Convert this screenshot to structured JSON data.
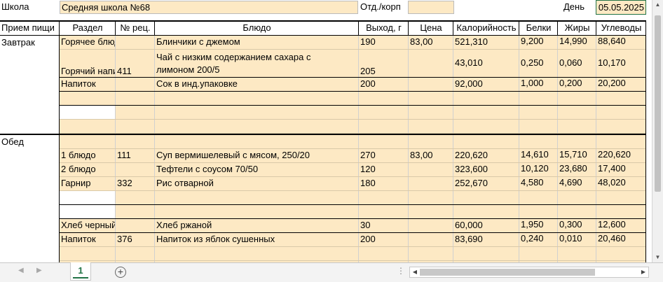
{
  "header": {
    "school_label": "Школа",
    "school_value": "Средняя школа №68",
    "dept_label": "Отд./корп",
    "dept_value": "",
    "day_label": "День",
    "day_value": "05.05.2025"
  },
  "columns": [
    "Прием пищи",
    "Раздел",
    "№ рец.",
    "Блюдо",
    "Выход, г",
    "Цена",
    "Калорийность",
    "Белки",
    "Жиры",
    "Углеводы"
  ],
  "meals": {
    "breakfast": "Завтрак",
    "lunch": "Обед"
  },
  "rows": [
    {
      "section": "Горячее блюдо",
      "recipe": "",
      "dish": "Блинчики с джемом",
      "dish2": "",
      "output": "190",
      "price": "83,00",
      "calories": "521,310",
      "proteins": "9,200",
      "fats": "14,990",
      "carbs": "88,640"
    },
    {
      "section": "Горячий напиток",
      "recipe": "411",
      "dish": "Чай с низким содержанием сахара с",
      "dish2": "лимоном 200/5",
      "output": "205",
      "price": "",
      "calories": "43,010",
      "proteins": "0,250",
      "fats": "0,060",
      "carbs": "10,170"
    },
    {
      "section": "Напиток",
      "recipe": "",
      "dish": "Сок в инд.упаковке",
      "dish2": "",
      "output": "200",
      "price": "",
      "calories": "92,000",
      "proteins": "1,000",
      "fats": "0,200",
      "carbs": "20,200"
    },
    {
      "section": "1 блюдо",
      "recipe": "111",
      "dish": "Суп вермишелевый с мясом, 250/20",
      "dish2": "",
      "output": "270",
      "price": "83,00",
      "calories": "220,620",
      "proteins": "14,610",
      "fats": "15,710",
      "carbs": "220,620"
    },
    {
      "section": "2 блюдо",
      "recipe": "",
      "dish": "Тефтели с соусом 70/50",
      "dish2": "",
      "output": "120",
      "price": "",
      "calories": "323,600",
      "proteins": "10,120",
      "fats": "23,680",
      "carbs": "17,400"
    },
    {
      "section": "Гарнир",
      "recipe": "332",
      "dish": "Рис отварной",
      "dish2": "",
      "output": "180",
      "price": "",
      "calories": "252,670",
      "proteins": "4,580",
      "fats": "4,690",
      "carbs": "48,020"
    },
    {
      "section": "Хлеб черный",
      "recipe": "",
      "dish": "Хлеб ржаной",
      "dish2": "",
      "output": "30",
      "price": "",
      "calories": "60,000",
      "proteins": "1,950",
      "fats": "0,300",
      "carbs": "12,600"
    },
    {
      "section": "Напиток",
      "recipe": "376",
      "dish": "Напиток из яблок сушенных",
      "dish2": "",
      "output": "200",
      "price": "",
      "calories": "83,690",
      "proteins": "0,240",
      "fats": "0,010",
      "carbs": "20,460"
    }
  ],
  "sheet_tab": "1",
  "icons": {
    "add_sheet": "plus-circle-icon",
    "tab_prev": "arrow-left-icon",
    "tab_next": "arrow-right-icon"
  }
}
